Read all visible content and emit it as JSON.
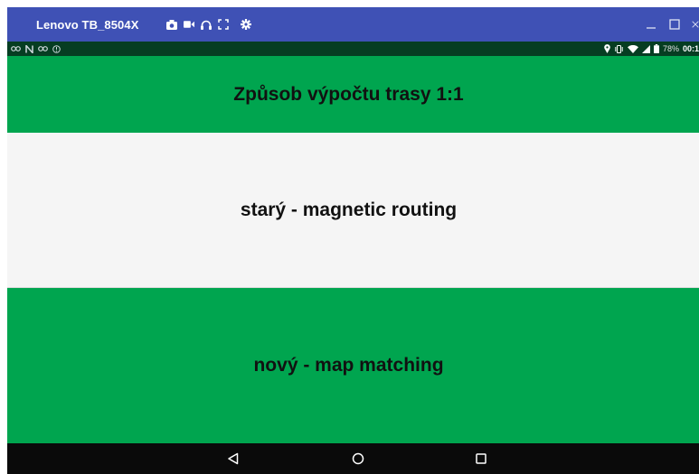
{
  "window": {
    "device_name": "Lenovo TB_8504X",
    "toolbar_icons": [
      "camera-icon",
      "video-icon",
      "headset-icon",
      "fullscreen-icon",
      "settings-icon"
    ],
    "controls": [
      "minimize-icon",
      "maximize-icon",
      "close-icon"
    ]
  },
  "status_bar": {
    "left_icons": [
      "link-icon",
      "nfc-icon",
      "link-icon",
      "info-icon"
    ],
    "right_icons": [
      "location-icon",
      "vibrate-icon",
      "wifi-icon",
      "signal-icon",
      "battery-icon"
    ],
    "battery_percent": "78%",
    "time": "00:1"
  },
  "app": {
    "title": "Způsob výpočtu trasy 1:1",
    "options": {
      "old": "starý - magnetic routing",
      "new": "nový - map matching"
    }
  },
  "nav_bar": {
    "buttons": [
      "back-icon",
      "home-icon",
      "recents-icon"
    ]
  },
  "colors": {
    "title_bar": "#3f51b5",
    "status_bar": "#063d22",
    "accent_green": "#00a54f",
    "option_light": "#f5f5f5",
    "nav_bar": "#0a0a0a"
  }
}
